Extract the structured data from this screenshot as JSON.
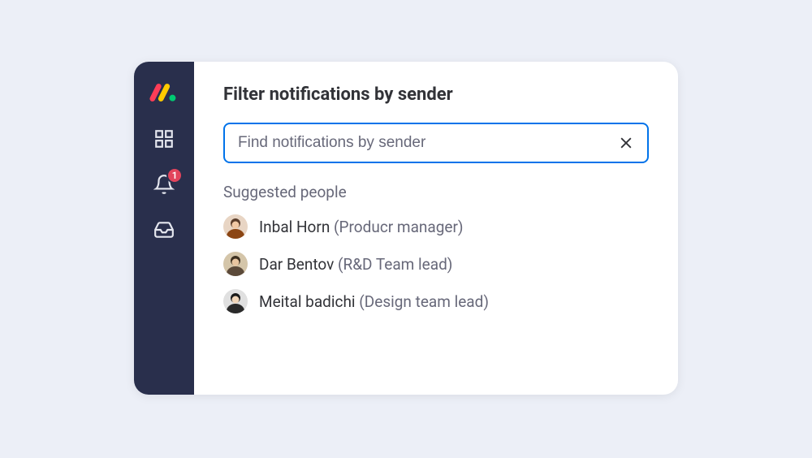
{
  "header": {
    "title": "Filter notifications by sender"
  },
  "search": {
    "placeholder": "Find notifications by sender"
  },
  "suggested": {
    "label": "Suggested people",
    "people": [
      {
        "name": "Inbal Horn",
        "role": "(Producr manager)"
      },
      {
        "name": "Dar Bentov",
        "role": "(R&D Team lead)"
      },
      {
        "name": "Meital badichi",
        "role": "(Design team lead)"
      }
    ]
  },
  "sidebar": {
    "notif_badge": "1"
  }
}
